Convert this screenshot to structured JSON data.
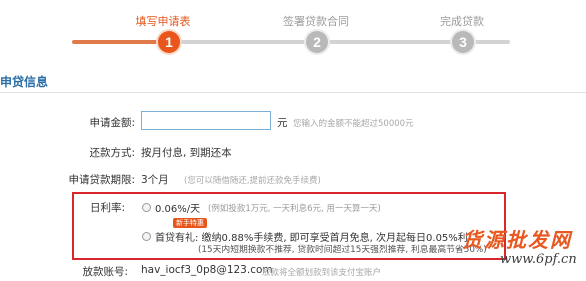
{
  "stepper": {
    "steps": [
      {
        "label": "填写申请表",
        "number": "1",
        "state": "active"
      },
      {
        "label": "签署贷款合同",
        "number": "2",
        "state": "inactive"
      },
      {
        "label": "完成贷款",
        "number": "3",
        "state": "inactive"
      }
    ]
  },
  "section": {
    "title": "申贷信息"
  },
  "form": {
    "amount": {
      "label": "申请金额:",
      "value": "",
      "unit": "元",
      "hint": "您输入的金额不能超过50000元"
    },
    "repayment": {
      "label": "还款方式:",
      "value": "按月付息, 到期还本"
    },
    "term": {
      "label": "申请贷款期限:",
      "value": "3个月",
      "hint": "(您可以随借随还,提前还款免手续费)"
    },
    "rate": {
      "label": "日利率:",
      "option1": {
        "text": "0.06%/天",
        "hint": "(例如投款1万元, 一天利息6元, 用一天算一天)"
      },
      "option2": {
        "badge": "新手特惠",
        "text": "首贷有礼: 缴纳0.88%手续费, 即可享受首月免息, 次月起每日0.05%利",
        "sub": "(15天内短期换款不推荐, 贷款时间超过15天强烈推荐, 利息最高节省50%)"
      }
    },
    "account": {
      "label": "放款账号:",
      "value": "hav_iocf3_0p8@123.com",
      "hint": "放款将全额划款到该支付宝账户"
    }
  },
  "watermark": {
    "text": "货源批发网",
    "url": "www.6pf.cn"
  },
  "colors": {
    "accent": "#e8561c",
    "highlight_border": "#d8262c",
    "link_blue": "#2b6ea6"
  }
}
